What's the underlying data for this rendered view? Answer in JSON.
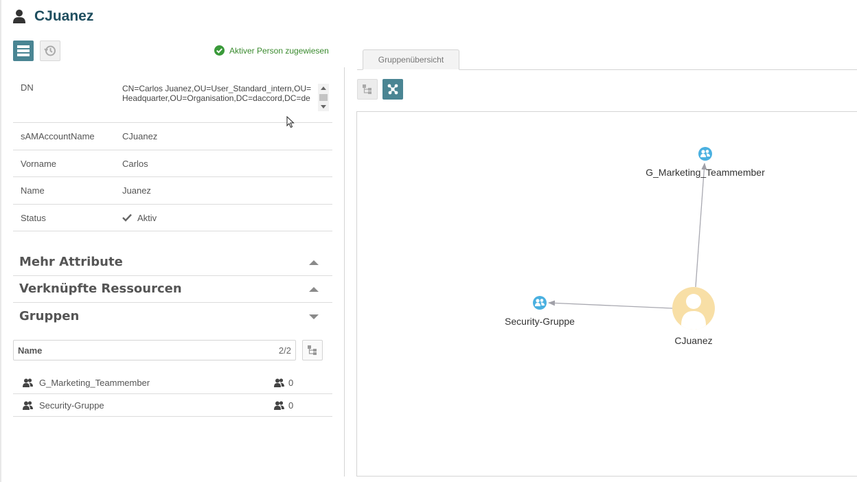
{
  "header": {
    "title": "CJuanez"
  },
  "toolbar": {
    "view_list": "list-view",
    "view_history": "history"
  },
  "assignment": {
    "text": "Aktiver Person zugewiesen"
  },
  "attributes": {
    "dn": {
      "label": "DN",
      "value": "CN=Carlos Juanez,OU=User_Standard_intern,OU=Headquarter,OU=Organisation,DC=daccord,DC=de"
    },
    "sam": {
      "label": "sAMAccountName",
      "value": "CJuanez"
    },
    "vorname": {
      "label": "Vorname",
      "value": "Carlos"
    },
    "name": {
      "label": "Name",
      "value": "Juanez"
    },
    "status": {
      "label": "Status",
      "value": "Aktiv"
    }
  },
  "sections": [
    {
      "label": "Mehr Attribute",
      "state": "collapsed"
    },
    {
      "label": "Verknüpfte Ressourcen",
      "state": "collapsed"
    },
    {
      "label": "Gruppen",
      "state": "expanded"
    }
  ],
  "groups_table": {
    "header_name": "Name",
    "count": "2/2",
    "rows": [
      {
        "name": "G_Marketing_Teammember",
        "members": "0"
      },
      {
        "name": "Security-Gruppe",
        "members": "0"
      }
    ]
  },
  "graph_panel": {
    "tab_label": "Gruppenübersicht",
    "nodes": {
      "marketing": "G_Marketing_Teammember",
      "security": "Security-Gruppe",
      "user": "CJuanez"
    }
  },
  "colors": {
    "accent": "#4a8593",
    "title": "#1f4e5f",
    "success": "#3a8a2e",
    "group_node": "#4ab0e0",
    "user_node": "#f8dfa6"
  }
}
